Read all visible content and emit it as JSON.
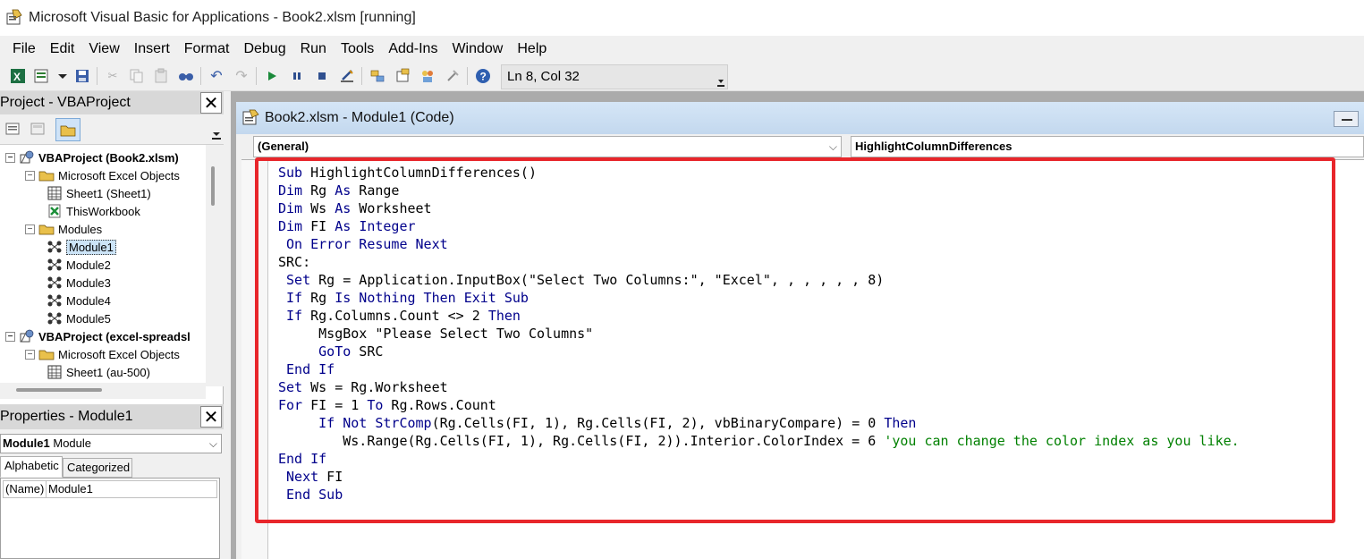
{
  "window": {
    "title": "Microsoft Visual Basic for Applications - Book2.xlsm [running]"
  },
  "menu": [
    "File",
    "Edit",
    "View",
    "Insert",
    "Format",
    "Debug",
    "Run",
    "Tools",
    "Add-Ins",
    "Window",
    "Help"
  ],
  "toolbar": {
    "cursor_position": "Ln 8, Col 32",
    "icons": [
      "excel-icon",
      "insert-module-icon",
      "dropdown-arrow-icon",
      "save-icon",
      "cut-icon",
      "copy-icon",
      "paste-icon",
      "find-icon",
      "undo-icon",
      "redo-icon",
      "run-icon",
      "break-icon",
      "reset-icon",
      "design-mode-icon",
      "project-explorer-icon",
      "properties-icon",
      "object-browser-icon",
      "toolbox-icon",
      "help-icon"
    ]
  },
  "project_pane": {
    "title": "Project - VBAProject",
    "tree": [
      {
        "label": "VBAProject (Book2.xlsm)",
        "bold": true,
        "toggle": "−",
        "icon": "vbaproject-icon"
      },
      {
        "label": "Microsoft Excel Objects",
        "bold": false,
        "toggle": "−",
        "icon": "folder-icon"
      },
      {
        "label": "Sheet1 (Sheet1)",
        "bold": false,
        "toggle": "",
        "icon": "sheet-icon"
      },
      {
        "label": "ThisWorkbook",
        "bold": false,
        "toggle": "",
        "icon": "workbook-icon"
      },
      {
        "label": "Modules",
        "bold": false,
        "toggle": "−",
        "icon": "folder-icon"
      },
      {
        "label": "Module1",
        "bold": false,
        "toggle": "",
        "icon": "module-icon",
        "selected": true
      },
      {
        "label": "Module2",
        "bold": false,
        "toggle": "",
        "icon": "module-icon"
      },
      {
        "label": "Module3",
        "bold": false,
        "toggle": "",
        "icon": "module-icon"
      },
      {
        "label": "Module4",
        "bold": false,
        "toggle": "",
        "icon": "module-icon"
      },
      {
        "label": "Module5",
        "bold": false,
        "toggle": "",
        "icon": "module-icon"
      },
      {
        "label": "VBAProject (excel-spreadsl",
        "bold": true,
        "toggle": "−",
        "icon": "vbaproject-icon"
      },
      {
        "label": "Microsoft Excel Objects",
        "bold": false,
        "toggle": "−",
        "icon": "folder-icon"
      },
      {
        "label": "Sheet1 (au-500)",
        "bold": false,
        "toggle": "",
        "icon": "sheet-icon"
      }
    ]
  },
  "properties_pane": {
    "title": "Properties - Module1",
    "object_name": "Module1",
    "object_type": "Module",
    "tabs": [
      "Alphabetic",
      "Categorized"
    ],
    "rows": [
      {
        "name": "(Name)",
        "value": "Module1"
      }
    ]
  },
  "code_window": {
    "title": "Book2.xlsm - Module1 (Code)",
    "object_dropdown": "(General)",
    "procedure_dropdown": "HighlightColumnDifferences",
    "code_lines": [
      [
        [
          "kw",
          "Sub"
        ],
        [
          "t",
          " HighlightColumnDifferences()"
        ]
      ],
      [
        [
          "kw",
          "Dim"
        ],
        [
          "t",
          " Rg "
        ],
        [
          "kw",
          "As"
        ],
        [
          "t",
          " Range"
        ]
      ],
      [
        [
          "kw",
          "Dim"
        ],
        [
          "t",
          " Ws "
        ],
        [
          "kw",
          "As"
        ],
        [
          "t",
          " Worksheet"
        ]
      ],
      [
        [
          "kw",
          "Dim"
        ],
        [
          "t",
          " FI "
        ],
        [
          "kw",
          "As"
        ],
        [
          "t",
          " "
        ],
        [
          "kw",
          "Integer"
        ]
      ],
      [
        [
          "t",
          " "
        ],
        [
          "kw",
          "On Error Resume Next"
        ]
      ],
      [
        [
          "t",
          "SRC:"
        ]
      ],
      [
        [
          "t",
          " "
        ],
        [
          "kw",
          "Set"
        ],
        [
          "t",
          " Rg = Application.InputBox(\"Select Two Columns:\", \"Excel\", , , , , , 8)"
        ]
      ],
      [
        [
          "t",
          " "
        ],
        [
          "kw",
          "If"
        ],
        [
          "t",
          " Rg "
        ],
        [
          "kw",
          "Is Nothing Then Exit Sub"
        ]
      ],
      [
        [
          "t",
          " "
        ],
        [
          "kw",
          "If"
        ],
        [
          "t",
          " Rg.Columns.Count <> 2 "
        ],
        [
          "kw",
          "Then"
        ]
      ],
      [
        [
          "t",
          "     MsgBox \"Please Select Two Columns\""
        ]
      ],
      [
        [
          "t",
          "     "
        ],
        [
          "kw",
          "GoTo"
        ],
        [
          "t",
          " SRC"
        ]
      ],
      [
        [
          "t",
          " "
        ],
        [
          "kw",
          "End If"
        ]
      ],
      [
        [
          "kw",
          "Set"
        ],
        [
          "t",
          " Ws = Rg.Worksheet"
        ]
      ],
      [
        [
          "kw",
          "For"
        ],
        [
          "t",
          " FI = 1 "
        ],
        [
          "kw",
          "To"
        ],
        [
          "t",
          " Rg.Rows.Count"
        ]
      ],
      [
        [
          "t",
          "     "
        ],
        [
          "kw",
          "If Not StrComp"
        ],
        [
          "t",
          "(Rg.Cells(FI, 1), Rg.Cells(FI, 2), vbBinaryCompare) = 0 "
        ],
        [
          "kw",
          "Then"
        ]
      ],
      [
        [
          "t",
          "        Ws.Range(Rg.Cells(FI, 1), Rg.Cells(FI, 2)).Interior.ColorIndex = 6 "
        ],
        [
          "cm",
          "'you can change the color index as you like."
        ]
      ],
      [
        [
          "kw",
          "End If"
        ]
      ],
      [
        [
          "t",
          " "
        ],
        [
          "kw",
          "Next"
        ],
        [
          "t",
          " FI"
        ]
      ],
      [
        [
          "t",
          " "
        ],
        [
          "kw",
          "End Sub"
        ]
      ]
    ]
  },
  "colors": {
    "keyword": "#00008b",
    "comment": "#008000",
    "highlight_box": "#e8262b"
  }
}
